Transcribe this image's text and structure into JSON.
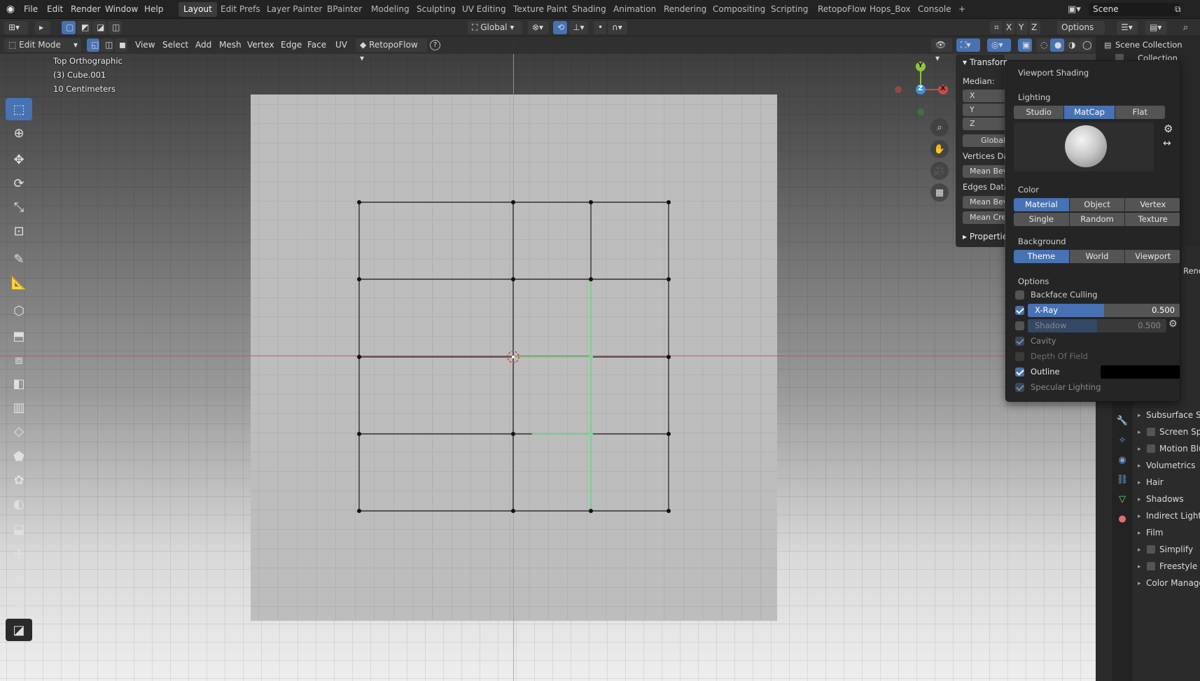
{
  "topbar": {
    "menus": [
      "File",
      "Edit",
      "Render",
      "Window",
      "Help"
    ],
    "workspaces": [
      "Layout",
      "Edit Prefs",
      "Layer Painter",
      "BPainter",
      "Modeling",
      "Sculpting",
      "UV Editing",
      "Texture Paint",
      "Shading",
      "Animation",
      "Rendering",
      "Compositing",
      "Scripting",
      "RetopoFlow",
      "Hops_Box",
      "Console"
    ],
    "active_workspace": "Layout",
    "add_tab": "+",
    "scene_label": "Scene"
  },
  "header2": {
    "orientation": "Global",
    "axis_x": "X",
    "axis_y": "Y",
    "axis_z": "Z",
    "options": "Options"
  },
  "header3": {
    "mode": "Edit Mode",
    "menus": [
      "View",
      "Select",
      "Add",
      "Mesh",
      "Vertex",
      "Edge",
      "Face",
      "UV"
    ],
    "retopoflow": "RetopoFlow",
    "help": "?"
  },
  "overlay": {
    "view_name": "Top Orthographic",
    "object": "(3) Cube.001",
    "scale": "10 Centimeters"
  },
  "gizmo": {
    "y": "Y",
    "x": "X",
    "z": "Z"
  },
  "npanel": {
    "transform": "Transform",
    "median": "Median:",
    "x": "X",
    "y": "Y",
    "z": "Z",
    "global": "Global",
    "vertices_data": "Vertices Data",
    "mean_bevel_v": "Mean Bevel",
    "edges_data": "Edges Data",
    "mean_bevel_e": "Mean Bevel",
    "mean_crease": "Mean Crease",
    "properties": "Properties"
  },
  "popover": {
    "title": "Viewport Shading",
    "lighting_label": "Lighting",
    "lighting": [
      "Studio",
      "MatCap",
      "Flat"
    ],
    "lighting_active": "MatCap",
    "color_label": "Color",
    "color_row1": [
      "Material",
      "Object",
      "Vertex"
    ],
    "color_row2": [
      "Single",
      "Random",
      "Texture"
    ],
    "color_active": "Material",
    "background_label": "Background",
    "background": [
      "Theme",
      "World",
      "Viewport"
    ],
    "background_active": "Theme",
    "options_label": "Options",
    "backface": "Backface Culling",
    "xray": "X-Ray",
    "xray_value": "0.500",
    "xray_fraction": 0.5,
    "shadow": "Shadow",
    "shadow_value": "0.500",
    "shadow_fraction": 0.5,
    "cavity": "Cavity",
    "dof": "Depth Of Field",
    "outline": "Outline",
    "outline_color": "#000000",
    "specular": "Specular Lighting"
  },
  "outliner": {
    "scene_collection": "Scene Collection",
    "collection": "Collection"
  },
  "properties": {
    "partial_label": "Rende",
    "items": [
      "Subsurface Sc",
      "Screen Spa",
      "Motion Blu",
      "Volumetrics",
      "Hair",
      "Shadows",
      "Indirect Lightin",
      "Film",
      "Simplify",
      "Freestyle",
      "Color Manage"
    ]
  },
  "colors": {
    "accent": "#4772b3",
    "axis_x": "#c94a4a",
    "axis_y": "#8cc63f",
    "axis_z": "#3e8fd6"
  }
}
